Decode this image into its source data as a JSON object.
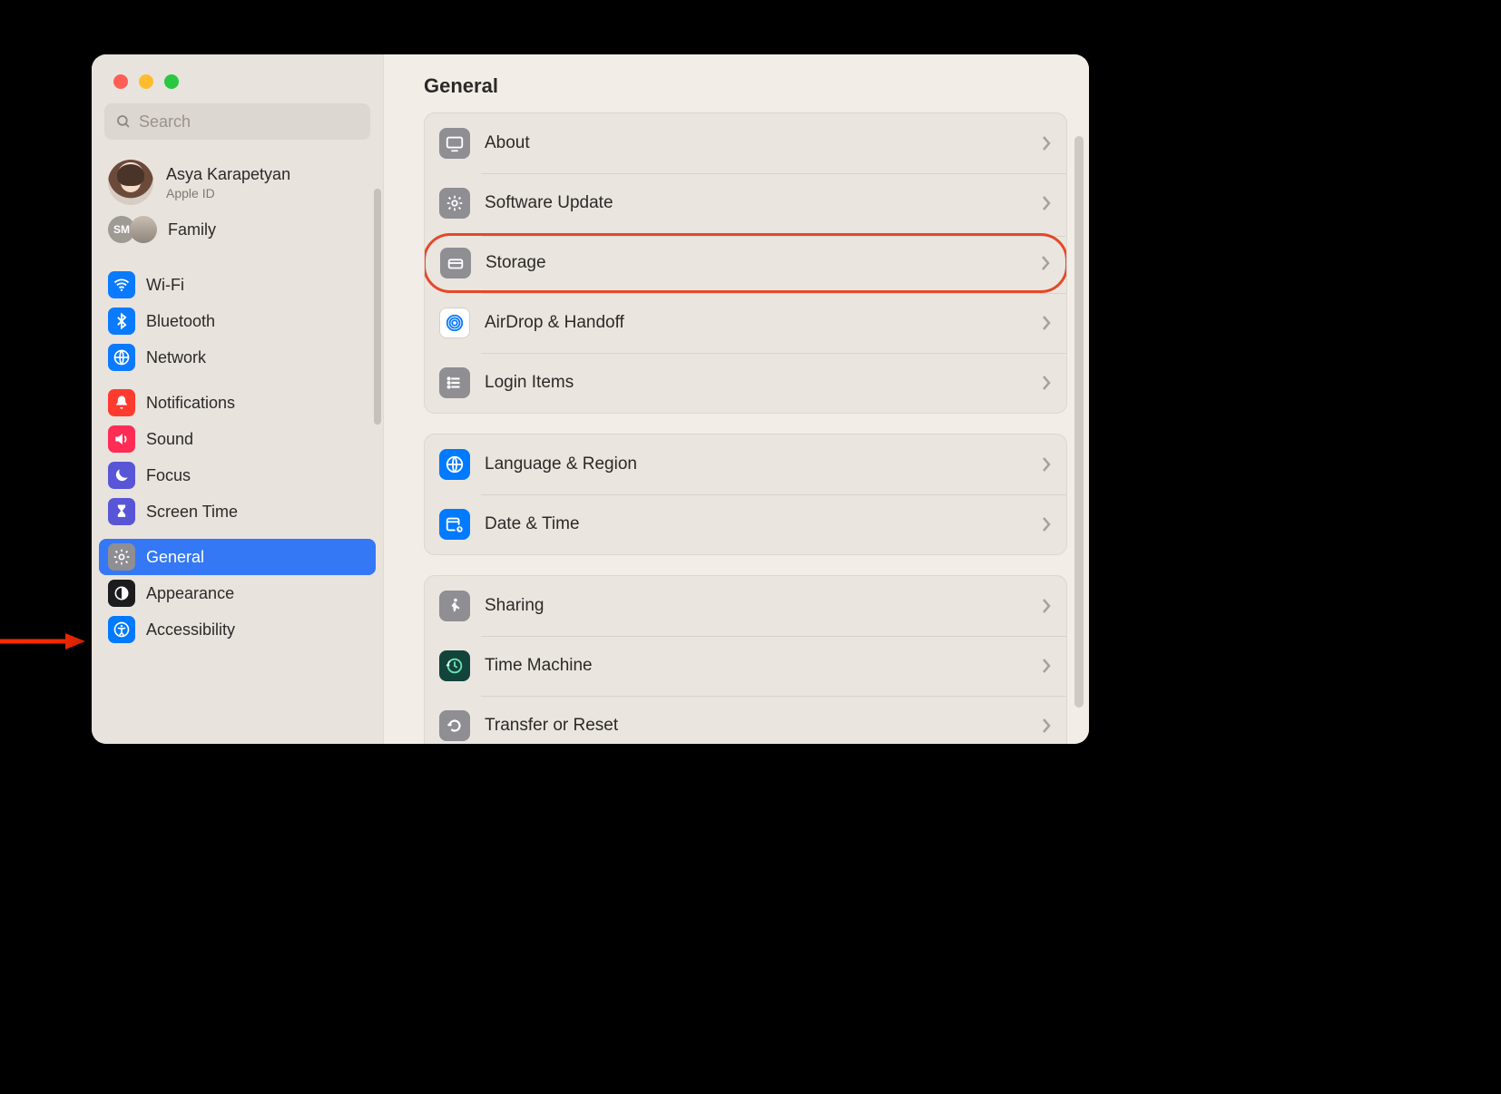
{
  "search": {
    "placeholder": "Search"
  },
  "account": {
    "name": "Asya Karapetyan",
    "subtitle": "Apple ID",
    "family_label": "Family",
    "family_badge": "SM"
  },
  "sidebar": {
    "groups": [
      [
        {
          "label": "Wi-Fi"
        },
        {
          "label": "Bluetooth"
        },
        {
          "label": "Network"
        }
      ],
      [
        {
          "label": "Notifications"
        },
        {
          "label": "Sound"
        },
        {
          "label": "Focus"
        },
        {
          "label": "Screen Time"
        }
      ],
      [
        {
          "label": "General"
        },
        {
          "label": "Appearance"
        },
        {
          "label": "Accessibility"
        }
      ]
    ]
  },
  "main": {
    "title": "General",
    "sections": [
      [
        {
          "label": "About"
        },
        {
          "label": "Software Update"
        },
        {
          "label": "Storage"
        },
        {
          "label": "AirDrop & Handoff"
        },
        {
          "label": "Login Items"
        }
      ],
      [
        {
          "label": "Language & Region"
        },
        {
          "label": "Date & Time"
        }
      ],
      [
        {
          "label": "Sharing"
        },
        {
          "label": "Time Machine"
        },
        {
          "label": "Transfer or Reset"
        }
      ]
    ]
  }
}
